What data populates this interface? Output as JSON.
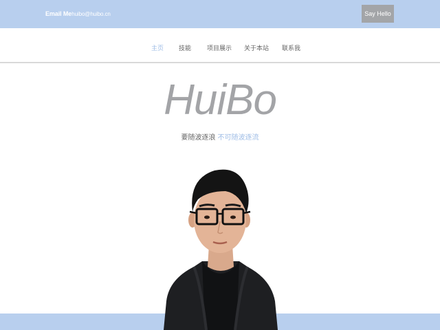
{
  "header": {
    "email_label": "Email Me",
    "email_address": "huibo@huibo.cn",
    "say_hello_label": "Say Hello"
  },
  "nav": {
    "items": [
      {
        "label": "主页",
        "active": true
      },
      {
        "label": "技能",
        "active": false
      },
      {
        "label": "项目展示",
        "active": false
      },
      {
        "label": "关于本站",
        "active": false
      },
      {
        "label": "联系我",
        "active": false
      }
    ]
  },
  "hero": {
    "logo_text": "HuiBo",
    "slogan_part1": "要随波逐浪",
    "slogan_part2": "不可随波逐流"
  },
  "colors": {
    "accent": "#b8cfee",
    "nav_active": "#9fbde6",
    "button": "#a3a5a8",
    "logo": "#a3a4a7"
  }
}
